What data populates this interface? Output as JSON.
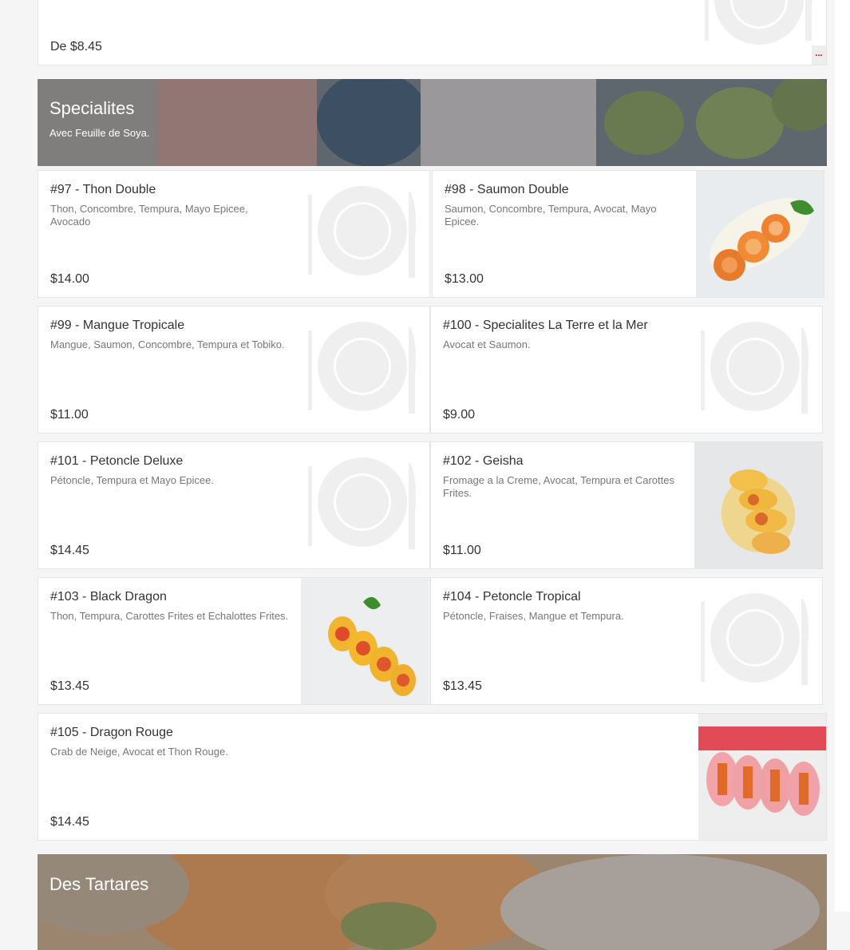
{
  "previous_item": {
    "price": "De $8.45",
    "more_label": "..."
  },
  "specialites": {
    "name": "Specialites",
    "subtitle": "Avec Feuille de Soya.",
    "items": [
      {
        "title": "#97 - Thon Double",
        "description": "Thon, Concombre, Tempura, Mayo Epicee, Avocado",
        "price": "$14.00"
      },
      {
        "title": "#98 - Saumon Double",
        "description": "Saumon, Concombre, Tempura, Avocat, Mayo Epicee.",
        "price": "$13.00"
      },
      {
        "title": "#99 - Mangue Tropicale",
        "description": "Mangue, Saumon, Concombre, Tempura et Tobiko.",
        "price": "$11.00"
      },
      {
        "title": "#100 - Specialites La Terre et la Mer",
        "description": "Avocat et Saumon.",
        "price": "$9.00"
      },
      {
        "title": "#101 - Petoncle Deluxe",
        "description": "Pétoncle, Tempura et Mayo Epicee.",
        "price": "$14.45"
      },
      {
        "title": "#102 - Geisha",
        "description": "Fromage a la Creme, Avocat, Tempura et Carottes Frites.",
        "price": "$11.00"
      },
      {
        "title": "#103 - Black Dragon",
        "description": "Thon, Tempura, Carottes Frites et Echalottes Frites.",
        "price": "$13.45"
      },
      {
        "title": "#104 - Petoncle Tropical",
        "description": "Pétoncle, Fraises, Mangue et Tempura.",
        "price": "$13.45"
      },
      {
        "title": "#105 - Dragon Rouge",
        "description": "Crab de Neige, Avocat et Thon Rouge.",
        "price": "$14.45"
      }
    ]
  },
  "tartares": {
    "name": "Des Tartares"
  }
}
